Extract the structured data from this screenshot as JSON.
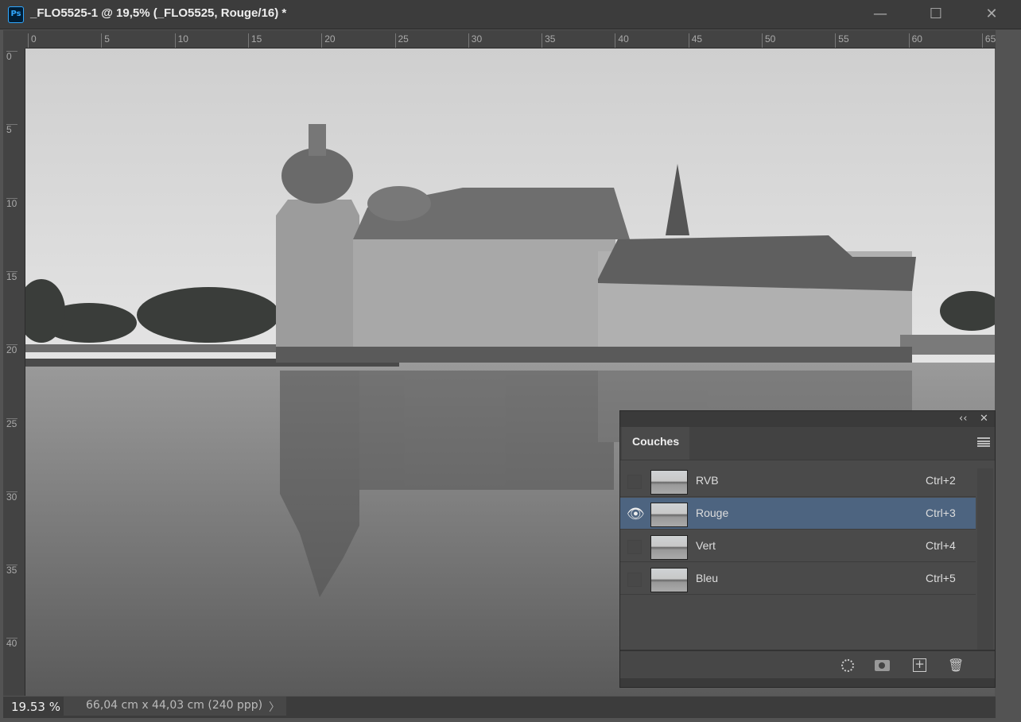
{
  "window": {
    "title": "_FLO5525-1 @ 19,5% (_FLO5525, Rouge/16) *",
    "app_icon": "Ps",
    "minimize": "—",
    "maximize": "☐",
    "close": "✕"
  },
  "ruler_top": [
    "0",
    "5",
    "10",
    "15",
    "20",
    "25",
    "30",
    "35",
    "40",
    "45",
    "50",
    "55",
    "60",
    "65"
  ],
  "ruler_left": [
    "0",
    "5",
    "10",
    "15",
    "20",
    "25",
    "30",
    "35",
    "40"
  ],
  "status": {
    "zoom": "19.53 %",
    "doc_info": "66,04 cm x 44,03 cm (240 ppp)",
    "arrow": "〉"
  },
  "panel": {
    "collapse": "‹‹",
    "close": "✕",
    "tab": "Couches",
    "channels": [
      {
        "name": "RVB",
        "shortcut": "Ctrl+2",
        "visible": false,
        "selected": false
      },
      {
        "name": "Rouge",
        "shortcut": "Ctrl+3",
        "visible": true,
        "selected": true
      },
      {
        "name": "Vert",
        "shortcut": "Ctrl+4",
        "visible": false,
        "selected": false
      },
      {
        "name": "Bleu",
        "shortcut": "Ctrl+5",
        "visible": false,
        "selected": false
      }
    ],
    "footer_icons": [
      "load-selection-icon",
      "save-selection-mask-icon",
      "new-channel-icon",
      "delete-icon"
    ]
  }
}
